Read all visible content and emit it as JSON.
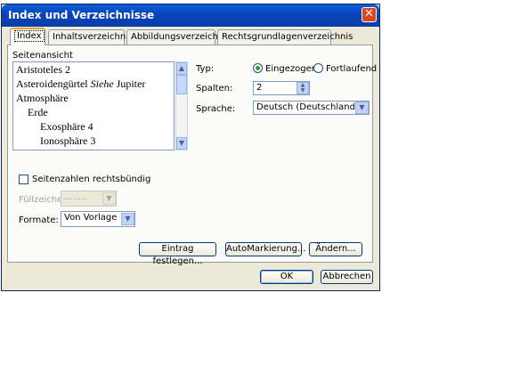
{
  "window": {
    "title": "Index und Verzeichnisse",
    "close_icon": "close-icon"
  },
  "tabs": [
    {
      "label": "Index",
      "active": true
    },
    {
      "label": "Inhaltsverzeichnis"
    },
    {
      "label": "Abbildungsverzeichnis"
    },
    {
      "label": "Rechtsgrundlagenverzeichnis"
    }
  ],
  "preview": {
    "label": "Seitenansicht",
    "lines": [
      {
        "text": "Aristoteles  2"
      },
      {
        "text": "Asteroidengürtel ",
        "italic": "Siehe",
        "rest": " Jupiter"
      },
      {
        "text": "Atmosphäre"
      },
      {
        "text": "Erde"
      },
      {
        "text": "Exosphäre  4"
      },
      {
        "text": "Ionosphäre  3"
      }
    ]
  },
  "typ": {
    "label": "Typ:",
    "option1": "Eingezogen",
    "option2": "Fortlaufend",
    "selected": "Eingezogen"
  },
  "spalten": {
    "label": "Spalten:",
    "value": "2"
  },
  "sprache": {
    "label": "Sprache:",
    "value": "Deutsch (Deutschland)"
  },
  "seitenzahlen": {
    "label": "Seitenzahlen rechtsbündig",
    "checked": false
  },
  "fuellzeichen": {
    "label": "Füllzeichen:",
    "value": "........"
  },
  "formate": {
    "label": "Formate:",
    "value": "Von Vorlage"
  },
  "buttons": {
    "eintrag": "Eintrag festlegen...",
    "automarkierung": "AutoMarkierung...",
    "aendern": "Ändern...",
    "ok": "OK",
    "abbrechen": "Abbrechen"
  },
  "colors": {
    "titlebar": "#0a5fd8",
    "dialog_bg": "#ece9d8",
    "tab_highlight": "#e7a23a"
  }
}
